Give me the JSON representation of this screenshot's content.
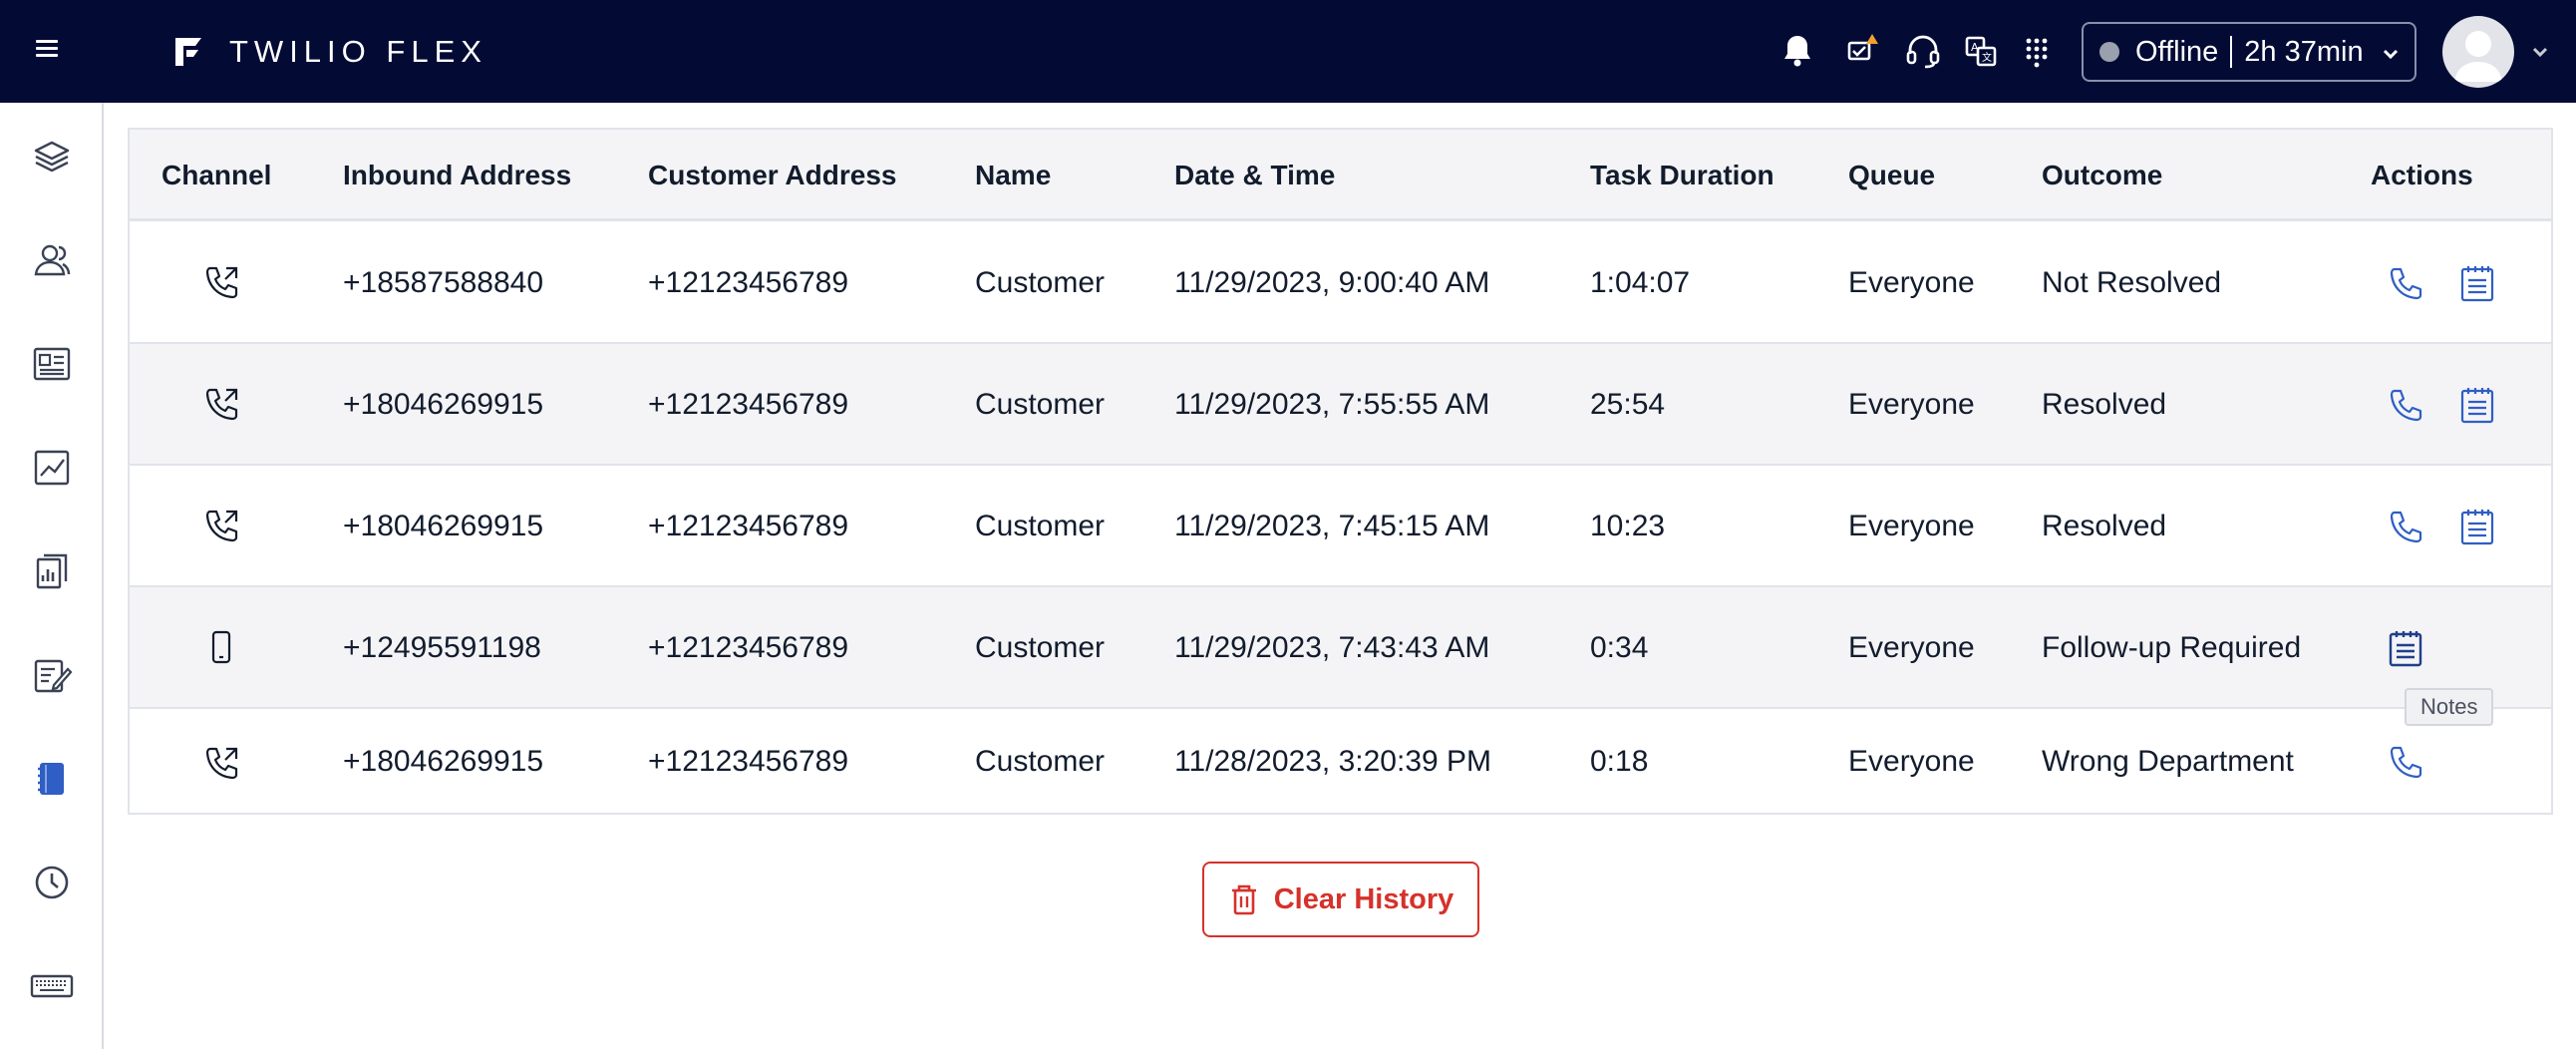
{
  "app": {
    "brand": "TWILIO FLEX"
  },
  "topbar": {
    "status_label": "Offline",
    "status_time": "2h 37min",
    "icons": [
      "bell-icon",
      "alert-tray-icon",
      "headset-icon",
      "translate-icon",
      "dialpad-grid-icon"
    ]
  },
  "sidebar": {
    "items": [
      "layers-icon",
      "contacts-icon",
      "profile-card-icon",
      "insights-chart-icon",
      "reports-icon",
      "survey-edit-icon",
      "notebook-icon",
      "history-clock-icon",
      "keyboard-icon"
    ],
    "active": "notebook-icon"
  },
  "table": {
    "headers": [
      "Channel",
      "Inbound Address",
      "Customer Address",
      "Name",
      "Date & Time",
      "Task Duration",
      "Queue",
      "Outcome",
      "Actions"
    ],
    "rows": [
      {
        "channel": "outbound-call-icon",
        "inbound": "+18587588840",
        "customer": "+12123456789",
        "name": "Customer",
        "datetime": "11/29/2023, 9:00:40 AM",
        "duration": "1:04:07",
        "queue": "Everyone",
        "outcome": "Not Resolved",
        "actions": [
          "call",
          "notes"
        ]
      },
      {
        "channel": "outbound-call-icon",
        "inbound": "+18046269915",
        "customer": "+12123456789",
        "name": "Customer",
        "datetime": "11/29/2023, 7:55:55 AM",
        "duration": "25:54",
        "queue": "Everyone",
        "outcome": "Resolved",
        "actions": [
          "call",
          "notes"
        ]
      },
      {
        "channel": "outbound-call-icon",
        "inbound": "+18046269915",
        "customer": "+12123456789",
        "name": "Customer",
        "datetime": "11/29/2023, 7:45:15 AM",
        "duration": "10:23",
        "queue": "Everyone",
        "outcome": "Resolved",
        "actions": [
          "call",
          "notes"
        ]
      },
      {
        "channel": "mobile-icon",
        "inbound": "+12495591198",
        "customer": "+12123456789",
        "name": "Customer",
        "datetime": "11/29/2023, 7:43:43 AM",
        "duration": "0:34",
        "queue": "Everyone",
        "outcome": "Follow-up Required",
        "actions": [
          "notes"
        ]
      },
      {
        "channel": "outbound-call-icon",
        "inbound": "+18046269915",
        "customer": "+12123456789",
        "name": "Customer",
        "datetime": "11/28/2023, 3:20:39 PM",
        "duration": "0:18",
        "queue": "Everyone",
        "outcome": "Wrong Department",
        "actions": [
          "call"
        ]
      }
    ]
  },
  "tooltip": {
    "text": "Notes"
  },
  "clear_history": {
    "label": "Clear History"
  },
  "colors": {
    "topbar_bg": "#030b35",
    "accent_blue": "#2f5ec4",
    "danger_red": "#d6312b",
    "row_alt": "#f4f4f6"
  }
}
